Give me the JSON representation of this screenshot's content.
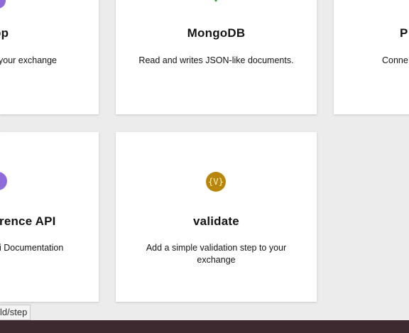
{
  "cards": {
    "top_left": {
      "title": "pp",
      "description": "your exchange"
    },
    "mongodb": {
      "title": "MongoDB",
      "description": "Read and writes JSON-like documents."
    },
    "top_right": {
      "title": "P",
      "description": "Conne"
    },
    "bottom_left": {
      "title": "rence API",
      "description": "i Documentation"
    },
    "validate": {
      "icon_text": "{V}",
      "title": "validate",
      "description": "Add a simple validation step to your exchange"
    }
  },
  "status_bar": {
    "url": "ld/step"
  },
  "colors": {
    "background": "#ececec",
    "card": "#ffffff",
    "validate_icon": "#b8860b",
    "purple_icon": "#8e6bd8",
    "mongodb_icon": "#3ba14a",
    "taskbar": "#3d2a31"
  }
}
